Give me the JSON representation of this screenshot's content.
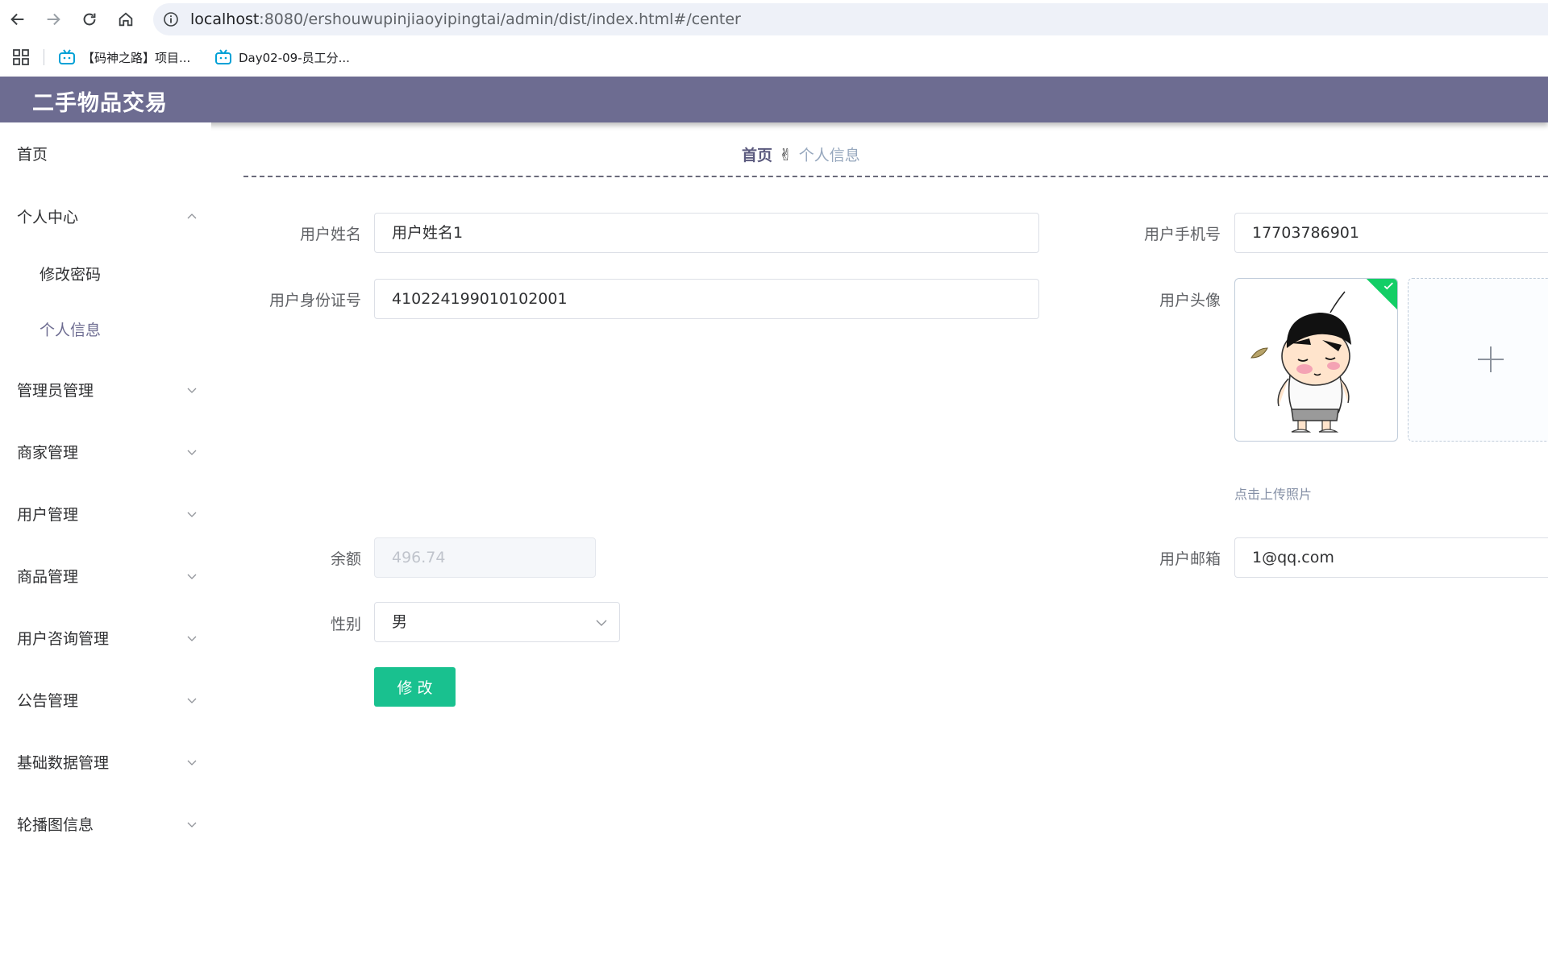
{
  "browser": {
    "url_host": "localhost",
    "url_rest": ":8080/ershouwupinjiaoyipingtai/admin/dist/index.html#/center",
    "bookmarks": [
      {
        "label": "【码神之路】项目..."
      },
      {
        "label": "Day02-09-员工分..."
      }
    ]
  },
  "app": {
    "title": "二手物品交易"
  },
  "sidebar": {
    "items": [
      {
        "label": "首页",
        "has_arrow": false
      },
      {
        "label": "个人中心",
        "has_arrow": true,
        "expanded": true
      },
      {
        "label": "修改密码",
        "sub": true
      },
      {
        "label": "个人信息",
        "sub": true,
        "active": true
      },
      {
        "label": "管理员管理",
        "has_arrow": true
      },
      {
        "label": "商家管理",
        "has_arrow": true
      },
      {
        "label": "用户管理",
        "has_arrow": true
      },
      {
        "label": "商品管理",
        "has_arrow": true
      },
      {
        "label": "用户咨询管理",
        "has_arrow": true
      },
      {
        "label": "公告管理",
        "has_arrow": true
      },
      {
        "label": "基础数据管理",
        "has_arrow": true
      },
      {
        "label": "轮播图信息",
        "has_arrow": true
      }
    ]
  },
  "breadcrumb": {
    "home": "首页",
    "separator": "✌",
    "current": "个人信息"
  },
  "form": {
    "name_label": "用户姓名",
    "name_value": "用户姓名1",
    "phone_label": "用户手机号",
    "phone_value": "17703786901",
    "idcard_label": "用户身份证号",
    "idcard_value": "410224199010102001",
    "avatar_label": "用户头像",
    "upload_tip": "点击上传照片",
    "balance_label": "余额",
    "balance_value": "496.74",
    "email_label": "用户邮箱",
    "email_value": "1@qq.com",
    "gender_label": "性别",
    "gender_value": "男",
    "submit_label": "修改"
  },
  "colors": {
    "header_bg": "#6d6c91",
    "submit_bg": "#19c18f",
    "active_menu": "#6d6c91"
  }
}
